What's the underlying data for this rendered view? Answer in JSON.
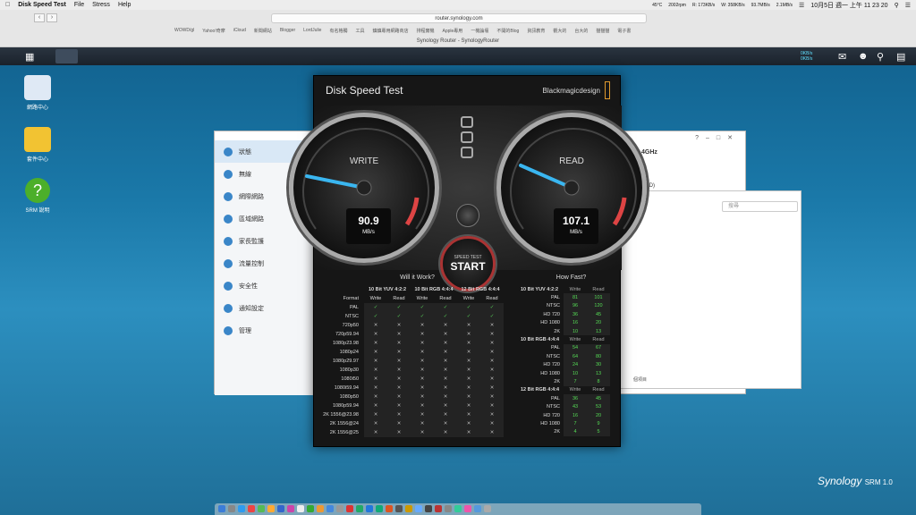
{
  "menubar": {
    "app_name": "Disk Speed Test",
    "items": [
      "File",
      "Stress",
      "Help"
    ],
    "status_temp": "45°C",
    "status_rpm": "2002rpm",
    "net_r": "R: 173KB/s",
    "net_w": "W: 358KB/s",
    "net_up": "93.7MB/s",
    "net_dn": "2.1MB/s",
    "clock": "10月5日 週一 上午 11 23 20"
  },
  "browser": {
    "url": "router.synology.com",
    "bookmarks": [
      "WOWD/gl",
      "Yahoo!奇摩",
      "iCloud",
      "新聞網站",
      "Blogger",
      "LordJulie",
      "有名格獨",
      "工具",
      "鎮鎮專用網路商店",
      "排程實機",
      "Apple專用",
      "一機論壇",
      "不開的Blog",
      "資訊教育",
      "觀大的",
      "台大的",
      "猫猫猫",
      "電子書"
    ],
    "tab_title": "Synology Router - SynologyRouter"
  },
  "dsm": {
    "speed_up": "0KB/s",
    "speed_down": "0KB/s"
  },
  "desktop_icons": [
    {
      "label": "網路中心",
      "color": "#dfe9f5"
    },
    {
      "label": "套件中心",
      "color": "#f2c332"
    },
    {
      "label": "SRM 說明",
      "color": "#4caf2a"
    }
  ],
  "srm_window": {
    "sidebar": [
      "狀態",
      "無線",
      "網際網路",
      "區域網路",
      "家長監護",
      "流量控制",
      "安全性",
      "通知設定",
      "管理"
    ],
    "wifi_label": "Fi 2.4GHz",
    "ssid_label": "SSID)",
    "search_placeholder": "搜尋",
    "footer": "個項目"
  },
  "disk_speed_test": {
    "title": "Disk Speed Test",
    "brand": "Blackmagicdesign",
    "write": {
      "label": "WRITE",
      "value": "90.9",
      "unit": "MB/s"
    },
    "read": {
      "label": "READ",
      "value": "107.1",
      "unit": "MB/s"
    },
    "start_small": "SPEED TEST",
    "start_big": "START",
    "will_it_work": {
      "heading": "Will it Work?",
      "groups": [
        "10 Bit YUV 4:2:2",
        "10 Bit RGB 4:4:4",
        "12 Bit RGB 4:4:4"
      ],
      "sub_headers": [
        "Format",
        "Write",
        "Read",
        "Write",
        "Read",
        "Write",
        "Read"
      ],
      "rows": [
        {
          "format": "PAL",
          "cells": [
            "✓",
            "✓",
            "✓",
            "✓",
            "✓",
            "✓"
          ]
        },
        {
          "format": "NTSC",
          "cells": [
            "✓",
            "✓",
            "✓",
            "✓",
            "✓",
            "✓"
          ]
        },
        {
          "format": "720p50",
          "cells": [
            "✕",
            "✕",
            "✕",
            "✕",
            "✕",
            "✕"
          ]
        },
        {
          "format": "720p59.94",
          "cells": [
            "✕",
            "✕",
            "✕",
            "✕",
            "✕",
            "✕"
          ]
        },
        {
          "format": "1080p23.98",
          "cells": [
            "✕",
            "✕",
            "✕",
            "✕",
            "✕",
            "✕"
          ]
        },
        {
          "format": "1080p24",
          "cells": [
            "✕",
            "✕",
            "✕",
            "✕",
            "✕",
            "✕"
          ]
        },
        {
          "format": "1080p29.97",
          "cells": [
            "✕",
            "✕",
            "✕",
            "✕",
            "✕",
            "✕"
          ]
        },
        {
          "format": "1080p30",
          "cells": [
            "✕",
            "✕",
            "✕",
            "✕",
            "✕",
            "✕"
          ]
        },
        {
          "format": "1080i50",
          "cells": [
            "✕",
            "✕",
            "✕",
            "✕",
            "✕",
            "✕"
          ]
        },
        {
          "format": "1080i59.94",
          "cells": [
            "✕",
            "✕",
            "✕",
            "✕",
            "✕",
            "✕"
          ]
        },
        {
          "format": "1080p50",
          "cells": [
            "✕",
            "✕",
            "✕",
            "✕",
            "✕",
            "✕"
          ]
        },
        {
          "format": "1080p59.94",
          "cells": [
            "✕",
            "✕",
            "✕",
            "✕",
            "✕",
            "✕"
          ]
        },
        {
          "format": "2K 1556@23.98",
          "cells": [
            "✕",
            "✕",
            "✕",
            "✕",
            "✕",
            "✕"
          ]
        },
        {
          "format": "2K 1556@24",
          "cells": [
            "✕",
            "✕",
            "✕",
            "✕",
            "✕",
            "✕"
          ]
        },
        {
          "format": "2K 1556@25",
          "cells": [
            "✕",
            "✕",
            "✕",
            "✕",
            "✕",
            "✕"
          ]
        }
      ]
    },
    "how_fast": {
      "heading": "How Fast?",
      "groups": [
        {
          "name": "10 Bit YUV 4:2:2",
          "rows": [
            [
              "PAL",
              "81",
              "101"
            ],
            [
              "NTSC",
              "96",
              "120"
            ],
            [
              "HD 720",
              "36",
              "45"
            ],
            [
              "HD 1080",
              "16",
              "20"
            ],
            [
              "2K",
              "10",
              "13"
            ]
          ]
        },
        {
          "name": "10 Bit RGB 4:4:4",
          "rows": [
            [
              "PAL",
              "54",
              "67"
            ],
            [
              "NTSC",
              "64",
              "80"
            ],
            [
              "HD 720",
              "24",
              "30"
            ],
            [
              "HD 1080",
              "10",
              "13"
            ],
            [
              "2K",
              "7",
              "8"
            ]
          ]
        },
        {
          "name": "12 Bit RGB 4:4:4",
          "rows": [
            [
              "PAL",
              "36",
              "45"
            ],
            [
              "NTSC",
              "43",
              "53"
            ],
            [
              "HD 720",
              "16",
              "20"
            ],
            [
              "HD 1080",
              "7",
              "9"
            ],
            [
              "2K",
              "4",
              "5"
            ]
          ]
        }
      ],
      "col_write": "Write",
      "col_read": "Read"
    }
  },
  "synology_logo": {
    "name": "Synology",
    "product": "SRM 1.0"
  }
}
